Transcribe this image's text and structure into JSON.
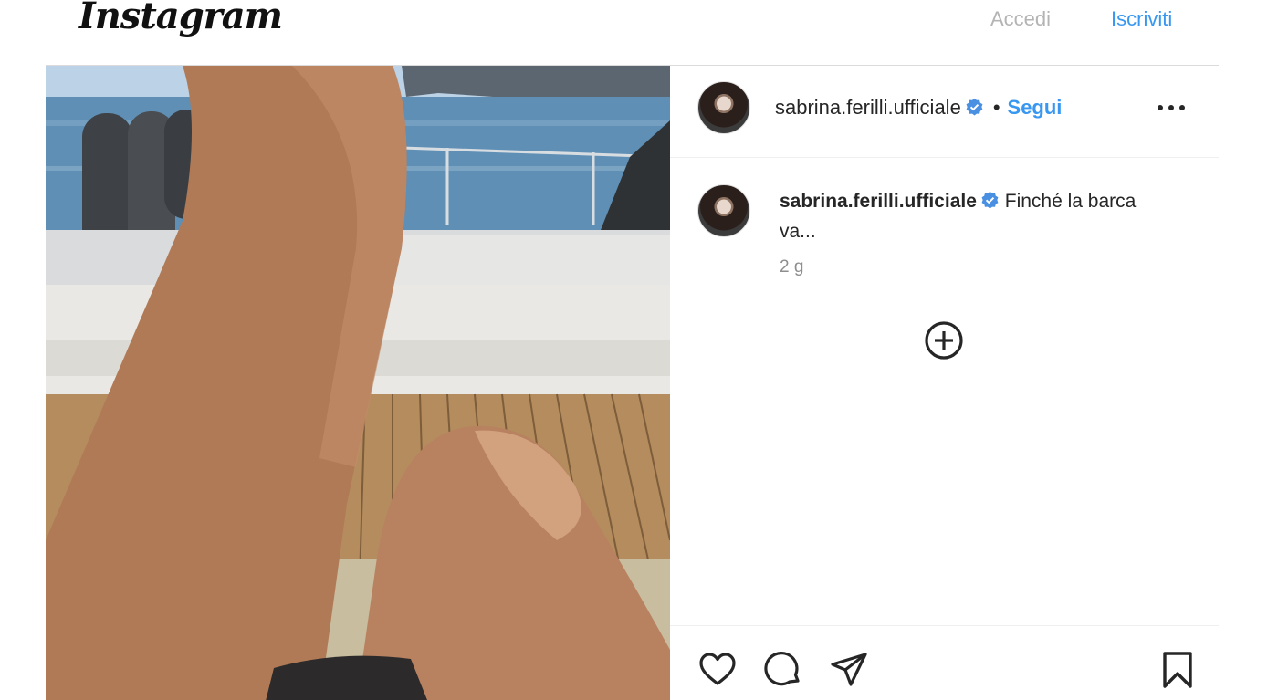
{
  "header": {
    "logo_text": "Instagram",
    "login_label": "Accedi",
    "signup_label": "Iscriviti"
  },
  "post": {
    "username": "sabrina.ferilli.ufficiale",
    "separator": "•",
    "follow_label": "Segui",
    "caption_text": "Finché la barca va...",
    "timestamp": "2 g",
    "icons": {
      "verified": "verified-badge-icon",
      "more": "more-options-icon",
      "load_more": "plus-circle-icon",
      "like": "heart-icon",
      "comment": "comment-icon",
      "share": "paper-plane-icon",
      "save": "bookmark-icon"
    }
  },
  "colors": {
    "link_blue": "#3897f0",
    "muted_gray": "#b4b4b4",
    "verified_blue": "#4a90e2"
  }
}
